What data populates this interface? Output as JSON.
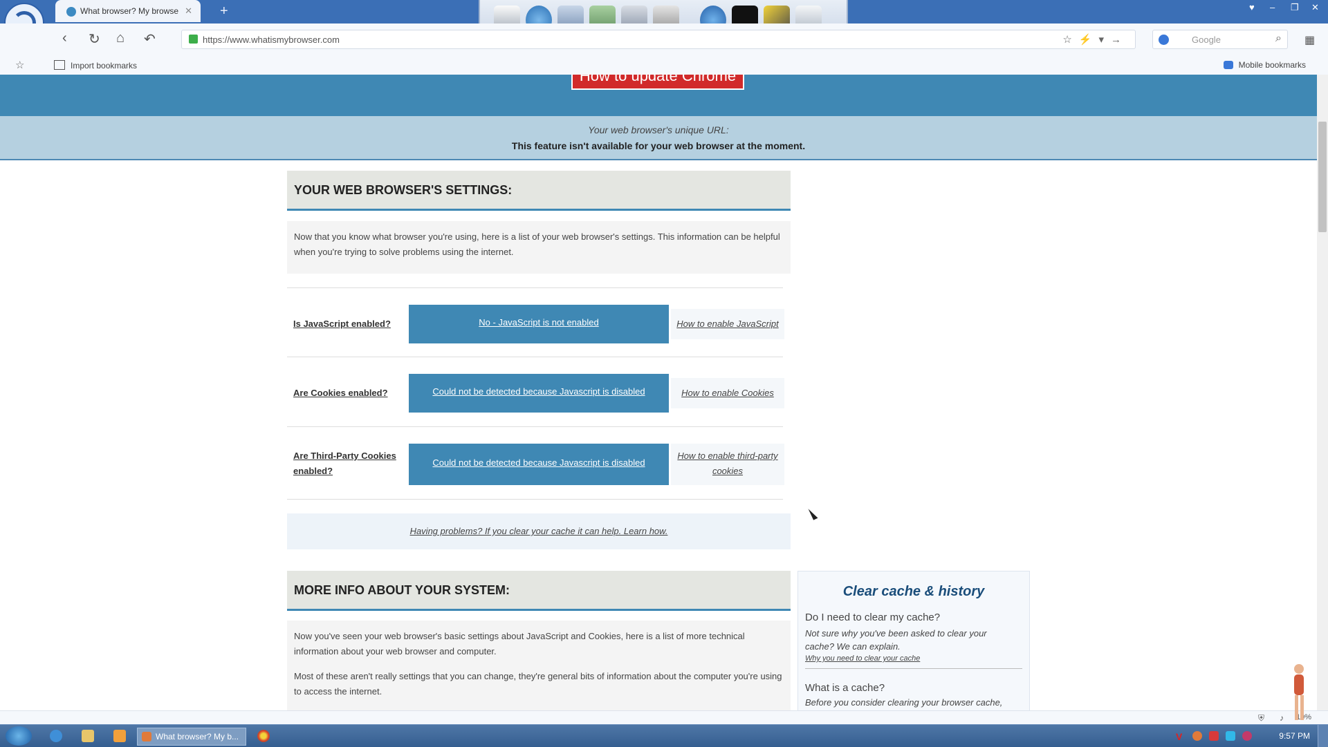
{
  "browser": {
    "tab_title": "What browser? My browse",
    "url": "https://www.whatismybrowser.com",
    "search_placeholder": "Google",
    "bookmarks": {
      "import_label": "Import bookmarks",
      "mobile_label": "Mobile bookmarks"
    },
    "zoom": "10%"
  },
  "page": {
    "update_button": "How to update Chrome",
    "unique_url_label": "Your web browser's unique URL:",
    "unique_url_msg": "This feature isn't available for your web browser at the moment.",
    "settings_heading": "YOUR WEB BROWSER'S SETTINGS:",
    "settings_intro": "Now that you know what browser you're using, here is a list of your web browser's settings. This information can be helpful when you're trying to solve problems using the internet.",
    "settings": [
      {
        "question": "Is JavaScript enabled?",
        "answer": "No - JavaScript is not enabled",
        "help": "How to enable JavaScript"
      },
      {
        "question": "Are Cookies enabled?",
        "answer": "Could not be detected because Javascript is disabled",
        "help": "How to enable Cookies"
      },
      {
        "question": "Are Third-Party Cookies enabled?",
        "answer": "Could not be detected because Javascript is disabled",
        "help": "How to enable third-party cookies"
      }
    ],
    "problems_link": "Having problems? If you clear your cache it can help. Learn how.",
    "more_heading": "MORE INFO ABOUT YOUR SYSTEM:",
    "more_intro_1": "Now you've seen your web browser's basic settings about JavaScript and Cookies, here is a list of more technical information about your web browser and computer.",
    "more_intro_2": "Most of these aren't really settings that you can change, they're general bits of information about the computer you're using to access the internet."
  },
  "cache_box": {
    "title": "Clear cache & history",
    "q1": "Do I need to clear my cache?",
    "d1": "Not sure why you've been asked to clear your cache? We can explain.",
    "link1": "Why you need to clear your cache",
    "q2": "What is a cache?",
    "d2": "Before you consider clearing your browser cache,"
  },
  "taskbar": {
    "active_window": "What browser? My b...",
    "clock": "9:57 PM"
  },
  "colors": {
    "accent": "#3f88b4",
    "update_red": "#d12a2a",
    "title_bar": "#3b6fb6"
  }
}
